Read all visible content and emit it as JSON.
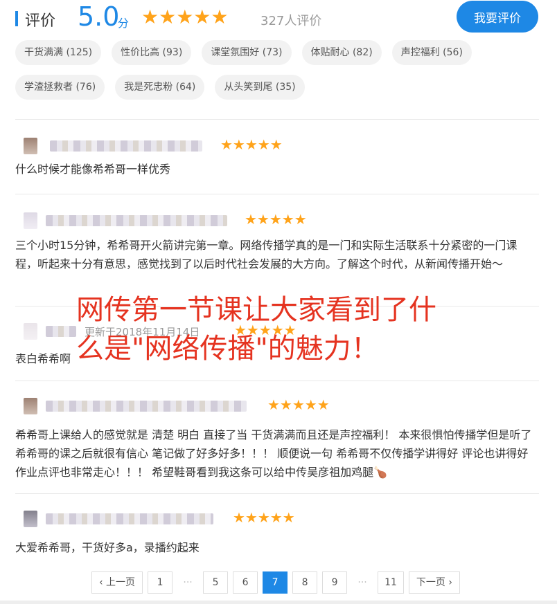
{
  "header": {
    "title": "评价",
    "score": "5.0",
    "score_unit": "分",
    "stars": "★★★★★",
    "count": "327人评价",
    "rate_button": "我要评价"
  },
  "tags": [
    "干货满满 (125)",
    "性价比高 (93)",
    "课堂氛围好 (73)",
    "体贴耐心 (82)",
    "声控福利 (56)",
    "学渣拯救者 (76)",
    "我是死忠粉 (64)",
    "从头笑到尾 (35)"
  ],
  "reviews": [
    {
      "stars": "★★★★★",
      "date": "",
      "content": "什么时候才能像希希哥一样优秀"
    },
    {
      "stars": "★★★★★",
      "date": "",
      "content": "三个小时15分钟，希希哥开火箭讲完第一章。网络传播学真的是一门和实际生活联系十分紧密的一门课程，听起来十分有意思，感觉找到了以后时代社会发展的大方向。了解这个时代，从新闻传播开始～"
    },
    {
      "stars": "★★★★★",
      "date": "更新于2018年11月14日",
      "content": "表白希希啊"
    },
    {
      "stars": "★★★★★",
      "date": "",
      "content": "希希哥上课给人的感觉就是 清楚 明白 直接了当 干货满满而且还是声控福利！ 本来很惧怕传播学但是听了希希哥的课之后就很有信心 笔记做了好多好多！！！ 顺便说一句 希希哥不仅传播学讲得好 评论也讲得好 作业点评也非常走心！！！ 希望鞋哥看到我这条可以给中传吴彦祖加鸡腿🍗"
    },
    {
      "stars": "★★★★★",
      "date": "",
      "content": "大爱希希哥，干货好多a，录播约起来"
    }
  ],
  "overlay": {
    "line1": "网传第一节课让大家看到了什",
    "line2": "么是\"网络传播\"的魅力！"
  },
  "pagination": {
    "prev": "‹ 上一页",
    "p1": "1",
    "dots": "···",
    "p5": "5",
    "p6": "6",
    "p7": "7",
    "p8": "8",
    "p9": "9",
    "p11": "11",
    "next": "下一页 ›"
  },
  "colors": {
    "accent": "#1e88e5",
    "star": "#ffa31a",
    "overlay": "#e53320"
  }
}
